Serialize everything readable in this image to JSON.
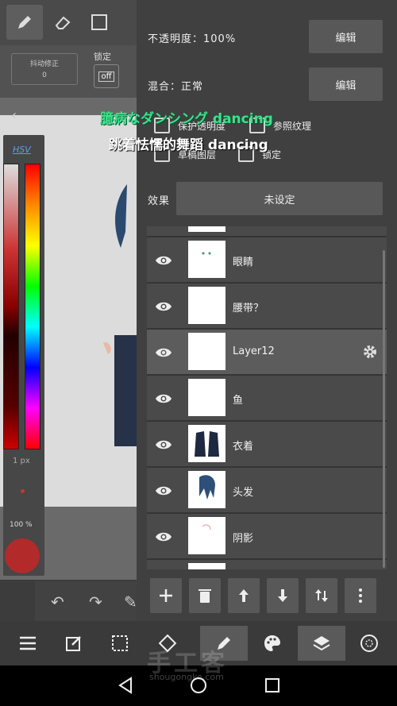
{
  "toolbar": {
    "stabilizer_label": "抖动修正",
    "stabilizer_value": "0",
    "lock_label": "锁定",
    "lock_toggle": "off"
  },
  "color_panel": {
    "mode_label": "HSV",
    "brush_size": "1 px",
    "brush_opacity": "100 %",
    "current_color": "#b22a2a"
  },
  "layer_panel": {
    "opacity_label": "不透明度：100%",
    "blend_label": "混合：正常",
    "edit_button": "编辑",
    "protect_alpha_label": "保护透明度",
    "reference_label": "参照纹理",
    "draft_layer_label": "草稿图层",
    "lock_label": "锁定",
    "effect_label": "效果",
    "effect_value": "未设定",
    "layers": [
      {
        "name": "眼睛",
        "selected": false
      },
      {
        "name": "腰带？",
        "selected": false
      },
      {
        "name": "Layer12",
        "selected": true
      },
      {
        "name": "鱼",
        "selected": false
      },
      {
        "name": "衣着",
        "selected": false
      },
      {
        "name": "头发",
        "selected": false
      },
      {
        "name": "阴影",
        "selected": false
      }
    ]
  },
  "overlay": {
    "caption_jp": "臆病なダンシング dancing",
    "caption_cn": "跳着怯懦的舞蹈 dancing",
    "watermark": "手工客",
    "watermark_url": "shougongke.com"
  },
  "colors": {
    "panel_bg": "#404040",
    "row_bg": "#4a4a4a",
    "row_selected": "#5c5c5c",
    "caption_green": "#3ee08a"
  }
}
